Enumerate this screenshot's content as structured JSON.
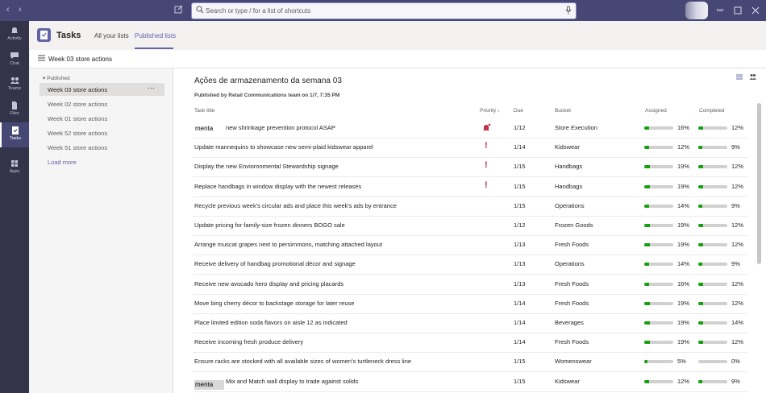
{
  "search": {
    "placeholder": "Search or type / for a list of shortcuts"
  },
  "rail": [
    {
      "label": "Activity",
      "icon": "bell-icon"
    },
    {
      "label": "Chat",
      "icon": "chat-icon"
    },
    {
      "label": "Teams",
      "icon": "teams-icon"
    },
    {
      "label": "Files",
      "icon": "files-icon"
    },
    {
      "label": "Tasks",
      "icon": "tasks-icon"
    },
    {
      "label": "Apps",
      "icon": "apps-icon"
    }
  ],
  "app": {
    "title": "Tasks",
    "tabs": [
      "All your lists",
      "Published lists"
    ]
  },
  "subheader": {
    "title": "Week 03 store actions"
  },
  "sidebar": {
    "section": "Published",
    "items": [
      "Week 03 store actions",
      "Week 02 store actions",
      "Week 01 store actions",
      "Week 52 store actions",
      "Week 51 store actions"
    ],
    "more": "···",
    "load_more": "Load more"
  },
  "plan": {
    "title": "Ações de armazenamento da semana 03",
    "published": "Published by Retail Communications team on 1/7, 7:35 PM"
  },
  "columns": {
    "task": "Task title",
    "priority": "Priority ↓",
    "due": "Due",
    "bucket": "Bucket",
    "assigned": "Assigned",
    "completed": "Completed"
  },
  "overlay_text": "menta",
  "tasks": [
    {
      "title": "new shrinkage prevention protocol ASAP",
      "priority": "urgent",
      "due": "1/12",
      "bucket": "Store Execution",
      "assigned": "16%",
      "completed": "12%"
    },
    {
      "title": "Update mannequins to showcase new semi-plaid kidswear apparel",
      "priority": "important",
      "due": "1/14",
      "bucket": "Kidswear",
      "assigned": "12%",
      "completed": "9%"
    },
    {
      "title": "Display the new Envioronmental Stewardship signage",
      "priority": "important",
      "due": "1/15",
      "bucket": "Handbags",
      "assigned": "19%",
      "completed": "12%"
    },
    {
      "title": "Replace handbags in window display with the newest releases",
      "priority": "important",
      "due": "1/15",
      "bucket": "Handbags",
      "assigned": "19%",
      "completed": "12%"
    },
    {
      "title": "Recycle previous week's circular ads and place this week's ads by entrance",
      "priority": "",
      "due": "1/15",
      "bucket": "Operations",
      "assigned": "14%",
      "completed": "9%"
    },
    {
      "title": "Update pricing for family-size frozen dinners BOGO sale",
      "priority": "",
      "due": "1/12",
      "bucket": "Frozen Goods",
      "assigned": "19%",
      "completed": "12%"
    },
    {
      "title": "Arrange muscat grapes next to persimmons, matching attached layout",
      "priority": "",
      "due": "1/13",
      "bucket": "Fresh Foods",
      "assigned": "19%",
      "completed": "12%"
    },
    {
      "title": "Receive delivery of handbag promotional décor and signage",
      "priority": "",
      "due": "1/13",
      "bucket": "Operations",
      "assigned": "14%",
      "completed": "9%"
    },
    {
      "title": "Receive new avocado hero display and pricing placards",
      "priority": "",
      "due": "1/13",
      "bucket": "Fresh Foods",
      "assigned": "16%",
      "completed": "12%"
    },
    {
      "title": "Move bing cherry décor to backstage storage for later reuse",
      "priority": "",
      "due": "1/14",
      "bucket": "Fresh Foods",
      "assigned": "19%",
      "completed": "12%"
    },
    {
      "title": "Place limited edition soda flavors on aisle 12 as indicated",
      "priority": "",
      "due": "1/14",
      "bucket": "Beverages",
      "assigned": "19%",
      "completed": "14%"
    },
    {
      "title": "Receive incoming fresh produce delivery",
      "priority": "",
      "due": "1/14",
      "bucket": "Fresh Foods",
      "assigned": "19%",
      "completed": "12%"
    },
    {
      "title": "Ensure racks are stocked with all available sizes of women's turtleneck dress line",
      "priority": "",
      "due": "1/15",
      "bucket": "Womenswear",
      "assigned": "5%",
      "completed": "0%"
    },
    {
      "title": "Mix and Match wall display to trade against solids",
      "priority": "",
      "due": "1/15",
      "bucket": "Kidswear",
      "assigned": "12%",
      "completed": "9%"
    }
  ],
  "colors": {
    "brand": "#6264a7",
    "titlebar": "#464775",
    "rail": "#33344a",
    "progress": "#13a10e",
    "priority": "#c4314b"
  }
}
